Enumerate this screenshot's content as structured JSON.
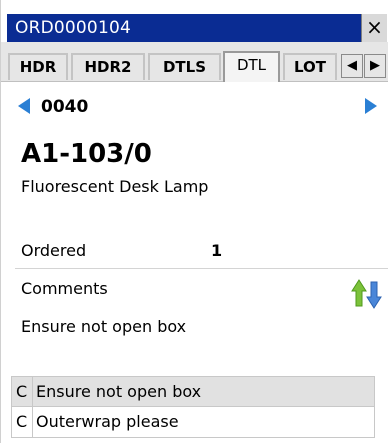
{
  "window": {
    "title": "ORD0000104",
    "close_label": "×"
  },
  "tabs": {
    "items": [
      {
        "label": "HDR",
        "active": false
      },
      {
        "label": "HDR2",
        "active": false
      },
      {
        "label": "DTLS",
        "active": false
      },
      {
        "label": "DTL",
        "active": true
      },
      {
        "label": "LOT",
        "active": false
      }
    ],
    "scroll_left": "◀",
    "scroll_right": "▶"
  },
  "detail": {
    "line_number": "0040",
    "item_code": "A1-103/0",
    "item_description": "Fluorescent Desk Lamp",
    "ordered_label": "Ordered",
    "ordered_value": "1",
    "comments_label": "Comments",
    "current_comment": "Ensure not open box"
  },
  "comments_list": [
    {
      "type": "C",
      "text": "Ensure not open box",
      "selected": true
    },
    {
      "type": "C",
      "text": "Outerwrap please",
      "selected": false
    }
  ],
  "colors": {
    "title_bar": "#0a2c93",
    "nav_arrow": "#2a7fd4",
    "sort_up": "#7cc23a",
    "sort_down": "#4a86d8"
  },
  "icons": {
    "prev": "left-arrow-icon",
    "next": "right-arrow-icon",
    "sort": "sort-up-down-icon",
    "close": "close-icon"
  }
}
